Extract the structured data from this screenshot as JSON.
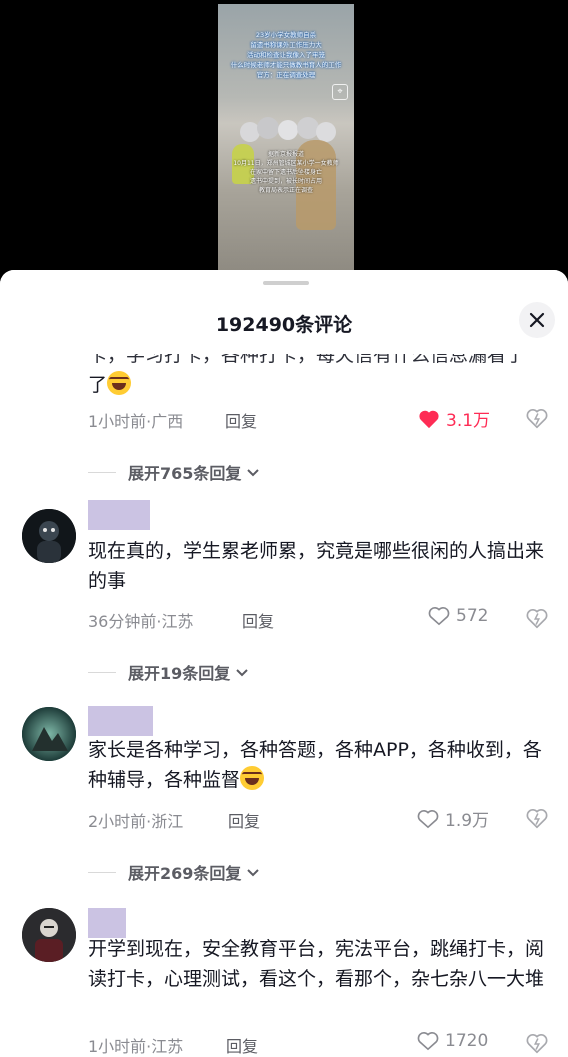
{
  "video": {
    "caption_top": [
      "23岁小学女教师自杀",
      "留遗书称课外工作压力大",
      "活动和检查让我像入了牢笼",
      "什么时候老师才能只做教书育人的工作",
      "官方：正在调查处理"
    ],
    "caption_bottom": [
      "据新京报报道",
      "10月11日，郑州管城区某小学一女教师",
      "在家中留下遗书后坠楼身亡",
      "遗书中提到，被长时间占用",
      "教育局表示正在调查"
    ]
  },
  "header": {
    "title": "192490条评论"
  },
  "comments": [
    {
      "text": "卡，学习打卡，各种打卡，每天信有什么信息漏看了",
      "meta": "1小时前·广西",
      "reply_label": "回复",
      "likes": "3.1万",
      "liked": true,
      "expand": "展开765条回复"
    },
    {
      "text": "现在真的，学生累老师累，究竟是哪些很闲的人搞出来的事",
      "meta": "36分钟前·江苏",
      "reply_label": "回复",
      "likes": "572",
      "liked": false,
      "expand": "展开19条回复"
    },
    {
      "text": "家长是各种学习，各种答题，各种APP，各种收到，各种辅导，各种监督",
      "meta": "2小时前·浙江",
      "reply_label": "回复",
      "likes": "1.9万",
      "liked": false,
      "expand": "展开269条回复"
    },
    {
      "text": "开学到现在，安全教育平台，宪法平台，跳绳打卡，阅读打卡，心理测试，看这个，看那个，杂七杂八一大堆",
      "meta": "1小时前·江苏",
      "reply_label": "回复",
      "likes": "1720",
      "liked": false
    }
  ],
  "colors": {
    "like_active": "#fe2c55",
    "username_placeholder": "#cbc3e3"
  }
}
